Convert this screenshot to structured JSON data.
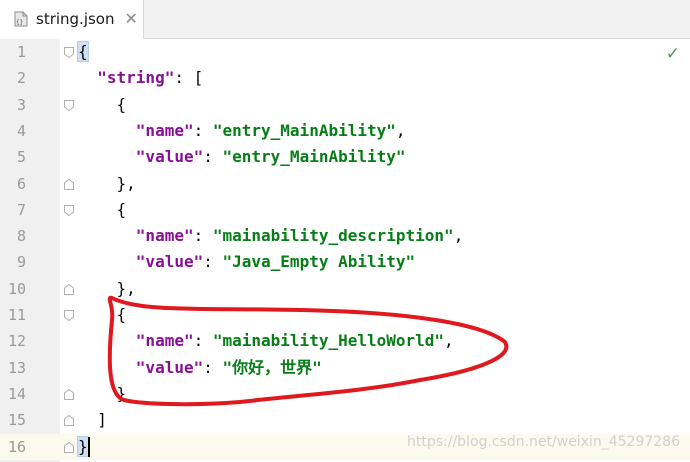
{
  "tab": {
    "title": "string.json",
    "close": "✕",
    "icon": "json-file-icon"
  },
  "status": {
    "check": "✓"
  },
  "lines": [
    {
      "num": "1",
      "parts": [
        [
          "bh",
          "{"
        ]
      ]
    },
    {
      "num": "2",
      "parts": [
        [
          "p",
          "  "
        ],
        [
          "k",
          "\"string\""
        ],
        [
          "p",
          ": ["
        ]
      ]
    },
    {
      "num": "3",
      "parts": [
        [
          "p",
          "    {"
        ]
      ]
    },
    {
      "num": "4",
      "parts": [
        [
          "p",
          "      "
        ],
        [
          "k",
          "\"name\""
        ],
        [
          "p",
          ": "
        ],
        [
          "s",
          "\"entry_MainAbility\""
        ],
        [
          "p",
          ","
        ]
      ]
    },
    {
      "num": "5",
      "parts": [
        [
          "p",
          "      "
        ],
        [
          "k",
          "\"value\""
        ],
        [
          "p",
          ": "
        ],
        [
          "s",
          "\"entry_MainAbility\""
        ]
      ]
    },
    {
      "num": "6",
      "parts": [
        [
          "p",
          "    },"
        ]
      ]
    },
    {
      "num": "7",
      "parts": [
        [
          "p",
          "    {"
        ]
      ]
    },
    {
      "num": "8",
      "parts": [
        [
          "p",
          "      "
        ],
        [
          "k",
          "\"name\""
        ],
        [
          "p",
          ": "
        ],
        [
          "s",
          "\"mainability_description\""
        ],
        [
          "p",
          ","
        ]
      ]
    },
    {
      "num": "9",
      "parts": [
        [
          "p",
          "      "
        ],
        [
          "k",
          "\"value\""
        ],
        [
          "p",
          ": "
        ],
        [
          "s",
          "\"Java_Empty Ability\""
        ]
      ]
    },
    {
      "num": "10",
      "parts": [
        [
          "p",
          "    },"
        ]
      ]
    },
    {
      "num": "11",
      "parts": [
        [
          "p",
          "    {"
        ]
      ]
    },
    {
      "num": "12",
      "parts": [
        [
          "p",
          "      "
        ],
        [
          "k",
          "\"name\""
        ],
        [
          "p",
          ": "
        ],
        [
          "s",
          "\"mainability_HelloWorld\""
        ],
        [
          "p",
          ","
        ]
      ]
    },
    {
      "num": "13",
      "parts": [
        [
          "p",
          "      "
        ],
        [
          "k",
          "\"value\""
        ],
        [
          "p",
          ": "
        ],
        [
          "s",
          "\"你好，世界\""
        ]
      ]
    },
    {
      "num": "14",
      "parts": [
        [
          "p",
          "    }"
        ]
      ]
    },
    {
      "num": "15",
      "parts": [
        [
          "p",
          "  ]"
        ]
      ]
    },
    {
      "num": "16",
      "parts": [
        [
          "bh",
          "}"
        ]
      ]
    }
  ],
  "watermark": "https://blog.csdn.net/weixin_45297286"
}
